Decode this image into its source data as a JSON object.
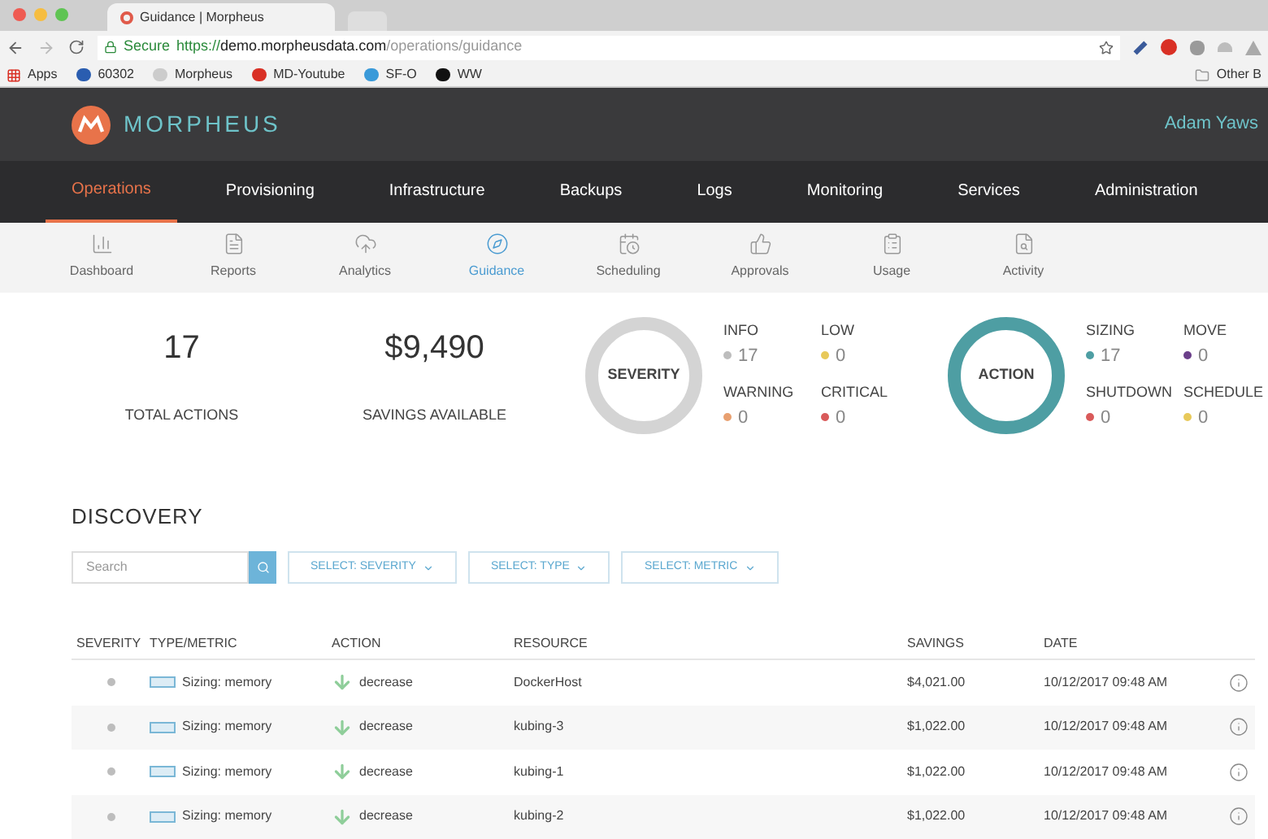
{
  "browser": {
    "tab_title": "Guidance | Morpheus",
    "secure": "Secure",
    "url_scheme": "https://",
    "url_host": "demo.morpheusdata.com",
    "url_path": "/operations/guidance",
    "bookmarks": [
      "Apps",
      "60302",
      "Morpheus",
      "MD-Youtube",
      "SF-O",
      "WW"
    ],
    "other_bookmarks": "Other B"
  },
  "header": {
    "logo": "MORPHEUS",
    "user": "Adam Yaws"
  },
  "nav": [
    {
      "label": "Operations",
      "selected": true
    },
    {
      "label": "Provisioning",
      "selected": false
    },
    {
      "label": "Infrastructure",
      "selected": false
    },
    {
      "label": "Backups",
      "selected": false
    },
    {
      "label": "Logs",
      "selected": false
    },
    {
      "label": "Monitoring",
      "selected": false
    },
    {
      "label": "Services",
      "selected": false
    },
    {
      "label": "Administration",
      "selected": false
    }
  ],
  "subnav": [
    {
      "label": "Dashboard",
      "selected": false
    },
    {
      "label": "Reports",
      "selected": false
    },
    {
      "label": "Analytics",
      "selected": false
    },
    {
      "label": "Guidance",
      "selected": true
    },
    {
      "label": "Scheduling",
      "selected": false
    },
    {
      "label": "Approvals",
      "selected": false
    },
    {
      "label": "Usage",
      "selected": false
    },
    {
      "label": "Activity",
      "selected": false
    }
  ],
  "stats": [
    {
      "value": "17",
      "label": "TOTAL ACTIONS"
    },
    {
      "value": "$9,490",
      "label": "SAVINGS AVAILABLE"
    }
  ],
  "donuts": [
    {
      "label": "SEVERITY",
      "color": "#d4d4d4",
      "legend": [
        {
          "name": "INFO",
          "count": "17",
          "color": "#bdbdbd"
        },
        {
          "name": "LOW",
          "count": "0",
          "color": "#e8c95a"
        },
        {
          "name": "WARNING",
          "count": "0",
          "color": "#e8a070"
        },
        {
          "name": "CRITICAL",
          "count": "0",
          "color": "#d95a5a"
        }
      ]
    },
    {
      "label": "ACTION",
      "color": "#4e9ea3",
      "legend": [
        {
          "name": "SIZING",
          "count": "17",
          "color": "#4e9ea3"
        },
        {
          "name": "MOVE",
          "count": "0",
          "color": "#6b3f8a"
        },
        {
          "name": "SHUTDOWN",
          "count": "0",
          "color": "#d95a5a"
        },
        {
          "name": "SCHEDULE",
          "count": "0",
          "color": "#e8c95a"
        }
      ]
    }
  ],
  "discovery": {
    "title": "DISCOVERY",
    "search": {
      "placeholder": "Search"
    },
    "filters": [
      "SELECT: SEVERITY",
      "SELECT: TYPE",
      "SELECT: METRIC"
    ]
  },
  "table": {
    "columns": [
      "SEVERITY",
      "TYPE/METRIC",
      "ACTION",
      "RESOURCE",
      "SAVINGS",
      "DATE"
    ],
    "rows": [
      {
        "type": "Sizing: memory",
        "action": "decrease",
        "resource": "DockerHost",
        "savings": "$4,021.00",
        "date": "10/12/2017 09:48 AM"
      },
      {
        "type": "Sizing: memory",
        "action": "decrease",
        "resource": "kubing-3",
        "savings": "$1,022.00",
        "date": "10/12/2017 09:48 AM"
      },
      {
        "type": "Sizing: memory",
        "action": "decrease",
        "resource": "kubing-1",
        "savings": "$1,022.00",
        "date": "10/12/2017 09:48 AM"
      },
      {
        "type": "Sizing: memory",
        "action": "decrease",
        "resource": "kubing-2",
        "savings": "$1,022.00",
        "date": "10/12/2017 09:48 AM"
      }
    ]
  }
}
